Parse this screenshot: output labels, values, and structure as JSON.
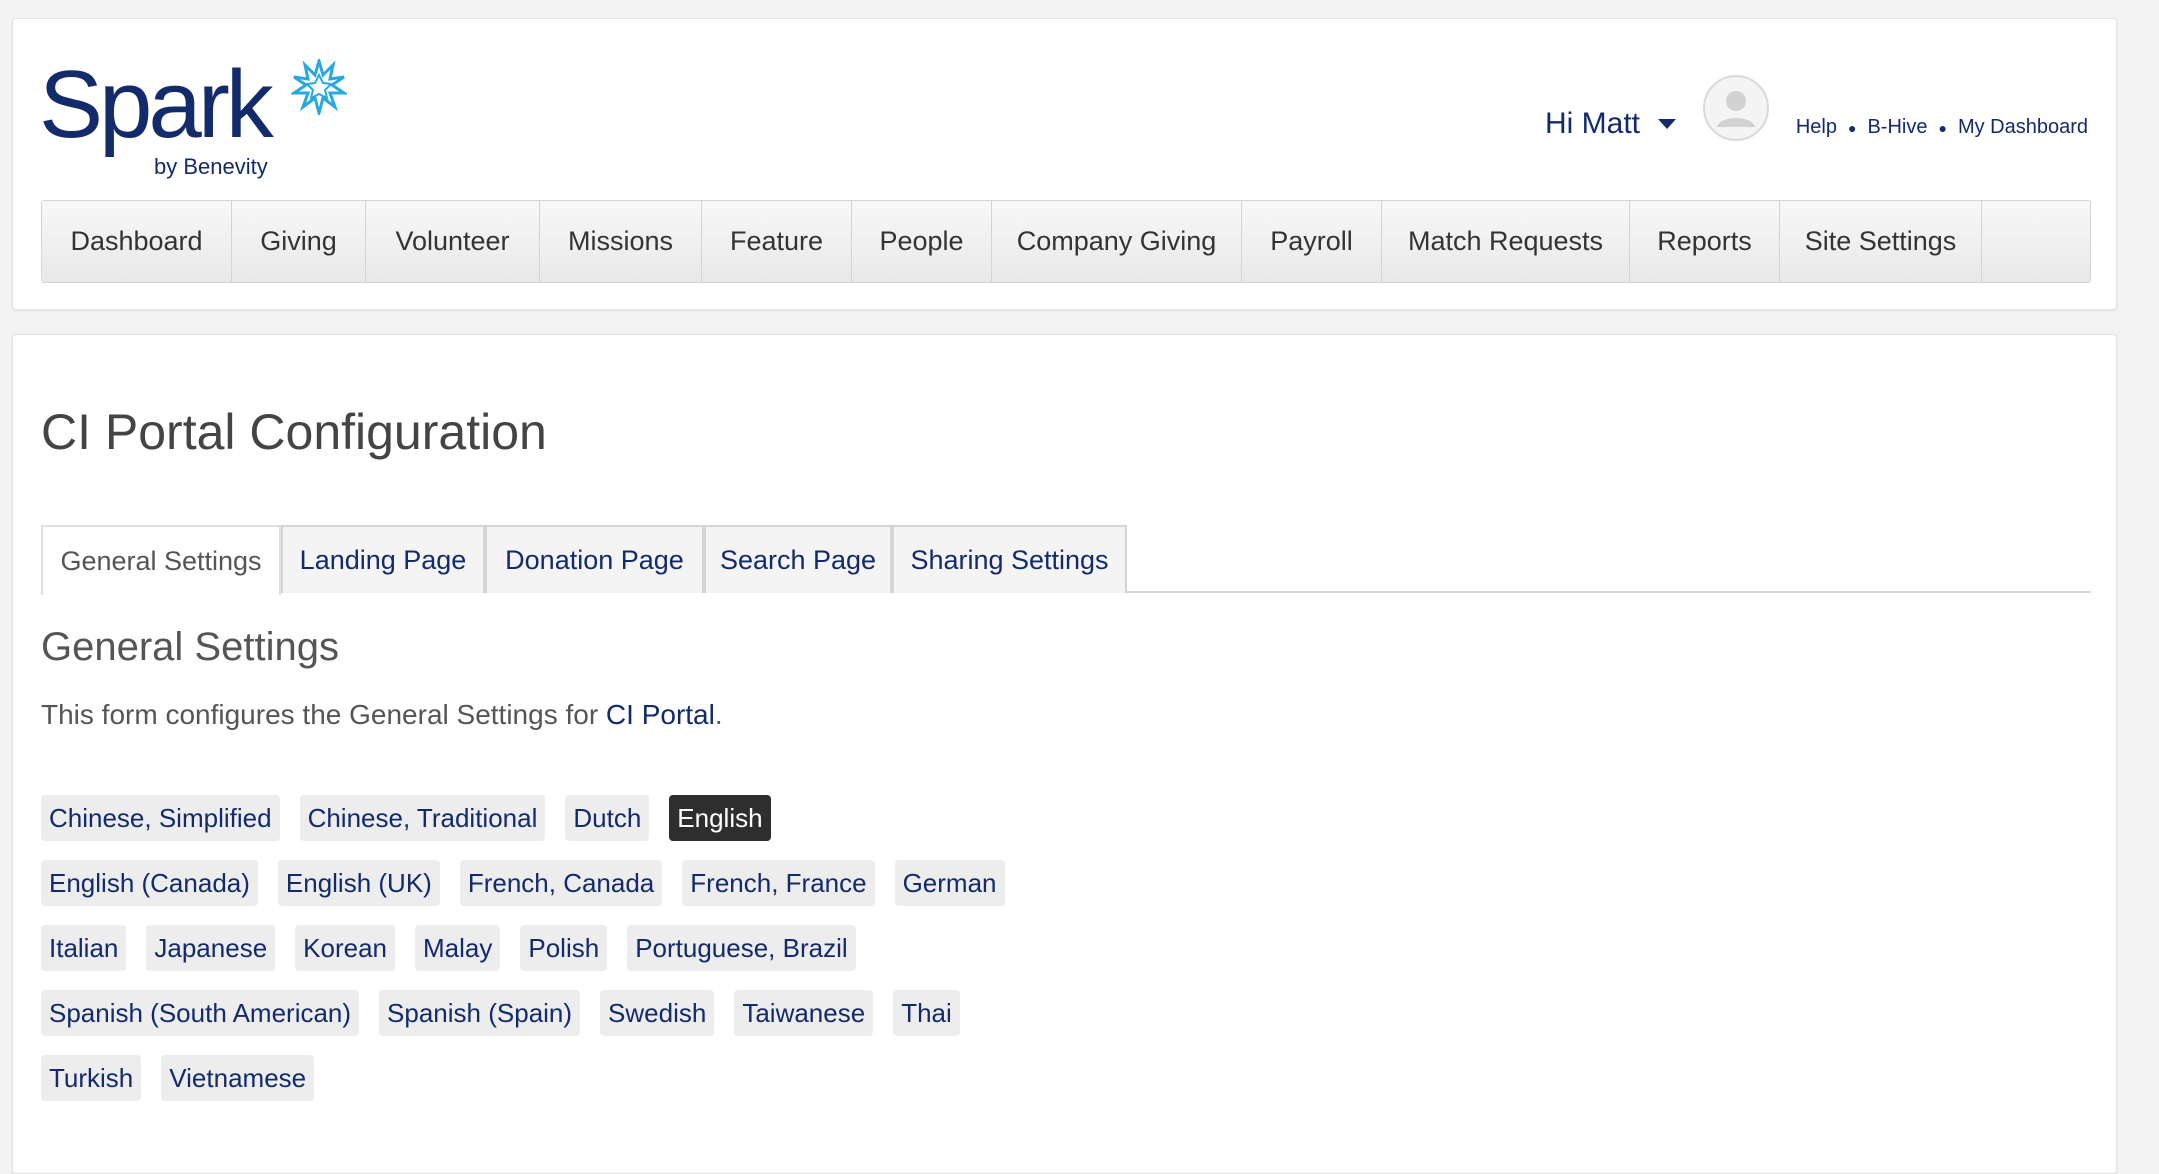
{
  "brand": {
    "name": "Spark",
    "subtitle": "by Benevity",
    "accent_color": "#29a8e0",
    "primary_color": "#132a6b"
  },
  "header": {
    "greeting": "Hi Matt",
    "links": [
      "Help",
      "B-Hive",
      "My Dashboard"
    ]
  },
  "nav": [
    {
      "label": "Dashboard"
    },
    {
      "label": "Giving"
    },
    {
      "label": "Volunteer"
    },
    {
      "label": "Missions"
    },
    {
      "label": "Feature"
    },
    {
      "label": "People"
    },
    {
      "label": "Company Giving"
    },
    {
      "label": "Payroll"
    },
    {
      "label": "Match Requests"
    },
    {
      "label": "Reports"
    },
    {
      "label": "Site Settings"
    }
  ],
  "page": {
    "title": "CI Portal Configuration",
    "tabs": [
      {
        "label": "General Settings",
        "active": true
      },
      {
        "label": "Landing Page"
      },
      {
        "label": "Donation Page"
      },
      {
        "label": "Search Page"
      },
      {
        "label": "Sharing Settings"
      }
    ],
    "section_title": "General Settings",
    "description_prefix": "This form configures the General Settings for ",
    "description_link": "CI Portal",
    "description_suffix": "."
  },
  "languages": {
    "selected": "English",
    "rows": [
      [
        "Chinese, Simplified",
        "Chinese, Traditional",
        "Dutch",
        "English"
      ],
      [
        "English (Canada)",
        "English (UK)",
        "French, Canada",
        "French, France",
        "German"
      ],
      [
        "Italian",
        "Japanese",
        "Korean",
        "Malay",
        "Polish",
        "Portuguese, Brazil"
      ],
      [
        "Spanish (South American)",
        "Spanish (Spain)",
        "Swedish",
        "Taiwanese",
        "Thai"
      ],
      [
        "Turkish",
        "Vietnamese"
      ]
    ]
  }
}
